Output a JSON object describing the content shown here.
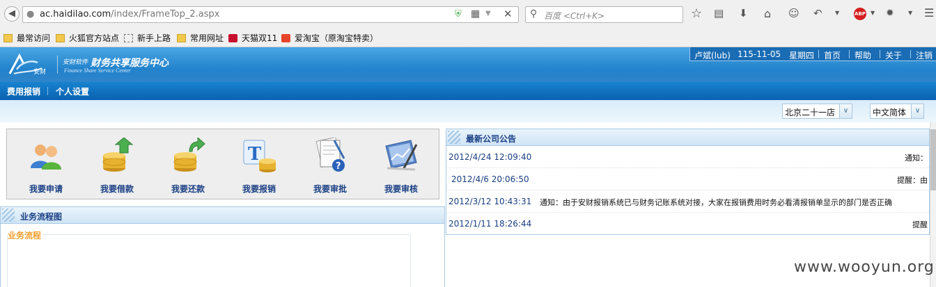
{
  "browser": {
    "url_host": "ac.haidilao.com",
    "url_path": "/index/FrameTop_2.aspx",
    "search_placeholder": "百度 <Ctrl+K>",
    "bookmarks": [
      "最常访问",
      "火狐官方站点",
      "新手上路",
      "常用网址",
      "天猫双11",
      "爱淘宝（原淘宝特卖）"
    ]
  },
  "header": {
    "logo_mark_text": "安财",
    "logo_sub": "安财软件",
    "logo_main": "财务共享服务中心",
    "logo_en": "Finance Share Service Center",
    "user": "卢斌(lub)",
    "date": "115-11-05",
    "weekday": "星期四",
    "links": [
      "首页",
      "帮助",
      "关于",
      "注销"
    ]
  },
  "menu": [
    "费用报销",
    "个人设置"
  ],
  "selectors": {
    "store": "北京二十一店",
    "language": "中文简体"
  },
  "quick_actions": [
    {
      "label": "我要申请",
      "icon": "users-icon"
    },
    {
      "label": "我要借款",
      "icon": "coins-arrow-up-icon"
    },
    {
      "label": "我要还款",
      "icon": "coins-arrow-return-icon"
    },
    {
      "label": "我要报销",
      "icon": "coins-text-icon"
    },
    {
      "label": "我要审批",
      "icon": "document-help-icon"
    },
    {
      "label": "我要审核",
      "icon": "chart-pen-icon"
    }
  ],
  "flow": {
    "title": "业务流程图",
    "legend": "业务流程"
  },
  "notices": {
    "title": "最新公司公告",
    "items": [
      {
        "date": "2012/4/24 12:09:40",
        "text": "通知："
      },
      {
        "date": "2012/4/6 20:06:50",
        "text": "提醒：由"
      },
      {
        "date": "2012/3/12 10:43:31",
        "text": "通知：由于安财报销系统已与财务记账系统对接，大家在报销费用时务必看清报销单显示的部门是否正确"
      },
      {
        "date": "2012/1/11 18:26:44",
        "text": "提醒"
      }
    ]
  },
  "watermark": "www.wooyun.org"
}
